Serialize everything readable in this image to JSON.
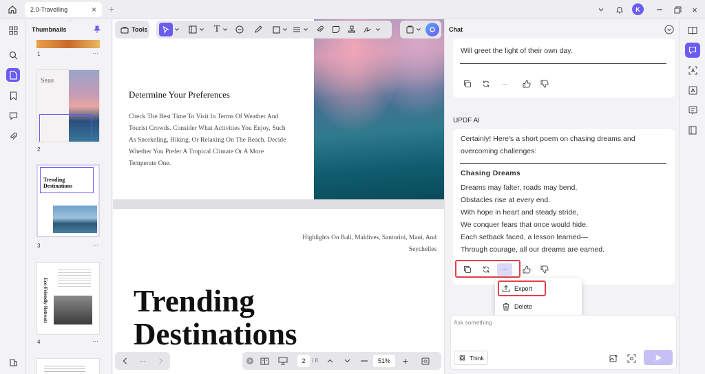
{
  "titlebar": {
    "tab_label": "2.0-Travelling",
    "avatar_letter": "K"
  },
  "thumbnails": {
    "title": "Thumbnails",
    "pages": [
      {
        "num": "1"
      },
      {
        "num": "2",
        "title_text": "Seas"
      },
      {
        "num": "3",
        "title_line1": "Trending",
        "title_line2": "Destinations"
      },
      {
        "num": "4",
        "vertical_title": "Eco-Friendly Retreats"
      }
    ],
    "more": "···"
  },
  "toolbar": {
    "tools_label": "Tools"
  },
  "document": {
    "heading": "Determine Your Preferences",
    "paragraph": "Check The Best Time To Visit In Terms Of Weather And Tourist Crowds. Consider What Activities You Enjoy, Such As Snorkeling, Hiking, Or Relaxing On The Beach. Decide Whether You Prefer A Tropical Climate Or A More Temperate One.",
    "highlights": "Highlights On Bali, Maldives, Santorini, Maui, And Seychelles",
    "big_title_1": "Trending",
    "big_title_2": "Destinations"
  },
  "bottombar": {
    "dots": "···",
    "page_current": "2",
    "page_sep": "/ 8",
    "zoom": "51%"
  },
  "chat": {
    "title": "Chat",
    "prev_message": "Will greet the light of their own day.",
    "sender": "UPDF AI",
    "intro": "Certainly! Here's a short poem on chasing dreams and overcoming challenges:",
    "poem_title": "Chasing Dreams",
    "poem_lines": [
      "Dreams may falter, roads may bend,",
      "Obstacles rise at every end.",
      "With hope in heart and steady stride,",
      "We conquer fears that once would hide.",
      "Each setback faced, a lesson learned—",
      "Through courage, all our dreams are earned."
    ],
    "menu": {
      "export": "Export",
      "delete": "Delete"
    },
    "input_placeholder": "Ask something",
    "think_label": "Think"
  },
  "colors": {
    "accent": "#6a5cf0",
    "highlight": "#e0404a"
  }
}
